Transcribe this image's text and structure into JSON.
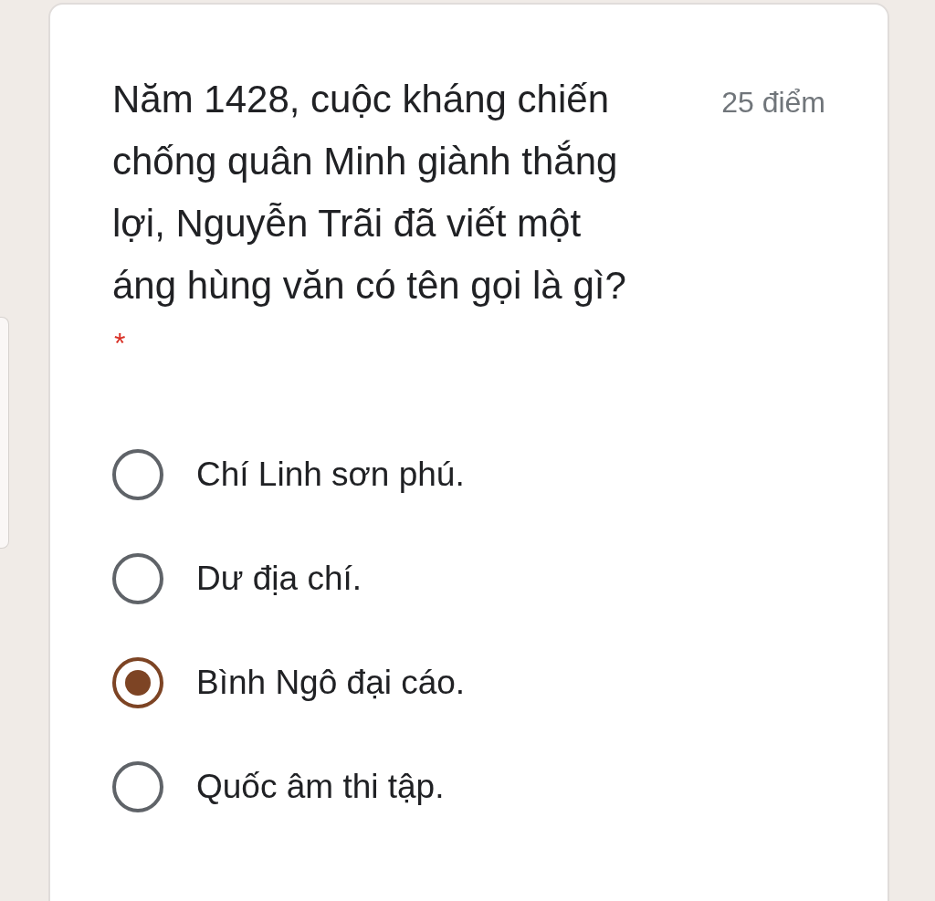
{
  "question": {
    "text": "Năm 1428, cuộc kháng chiến chống quân Minh giành thắng lợi, Nguyễn Trãi đã viết một áng hùng văn có tên gọi là gì?",
    "points": "25 điểm",
    "required_mark": "*"
  },
  "options": [
    {
      "label": "Chí Linh sơn phú.",
      "selected": false
    },
    {
      "label": "Dư địa chí.",
      "selected": false
    },
    {
      "label": "Bình Ngô đại cáo.",
      "selected": true
    },
    {
      "label": "Quốc âm thi tập.",
      "selected": false
    }
  ]
}
